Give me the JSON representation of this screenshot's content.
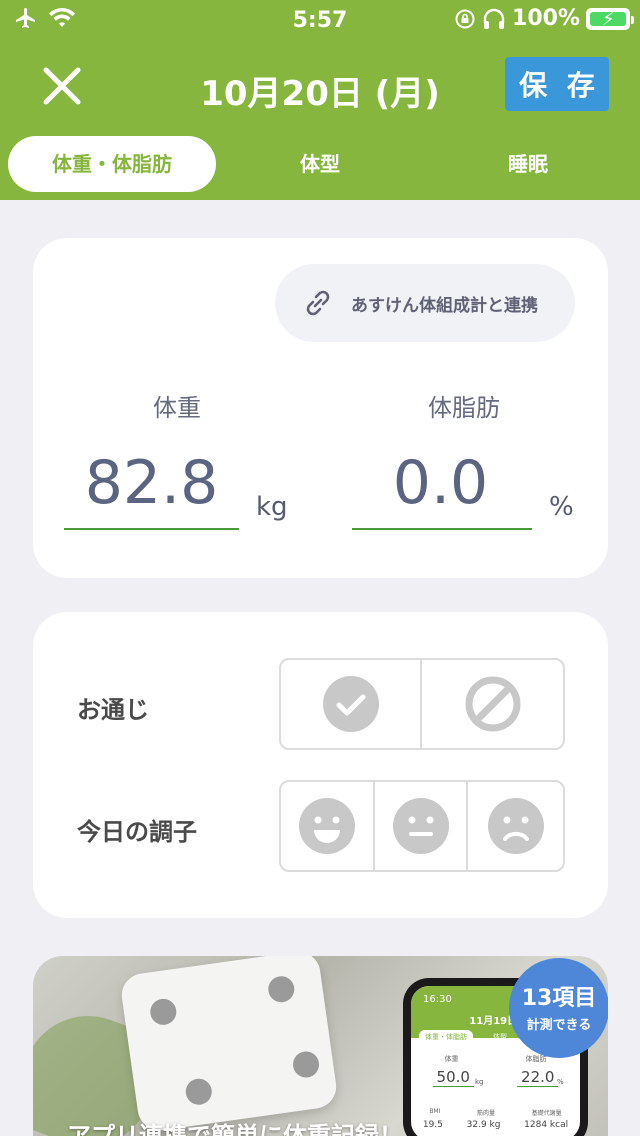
{
  "status_bar": {
    "time": "5:57",
    "battery": "100%",
    "icons": [
      "airplane-icon",
      "wifi-icon",
      "orientation-lock-icon",
      "headphones-icon",
      "battery-charging-icon"
    ]
  },
  "nav": {
    "title": "10月20日 (月)",
    "save_label": "保 存",
    "close_icon": "close-icon"
  },
  "tabs": [
    {
      "label": "体重・体脂肪",
      "active": true
    },
    {
      "label": "体型",
      "active": false
    },
    {
      "label": "睡眠",
      "active": false
    }
  ],
  "body_card": {
    "link_label": "あすけん体組成計と連携",
    "weight": {
      "label": "体重",
      "value": "82.8",
      "unit": "kg"
    },
    "body_fat": {
      "label": "体脂肪",
      "value": "0.0",
      "unit": "%"
    }
  },
  "condition_card": {
    "bowel": {
      "label": "お通じ",
      "options": [
        "check-icon",
        "none-icon"
      ]
    },
    "mood": {
      "label": "今日の調子",
      "options": [
        "smile-face-icon",
        "neutral-face-icon",
        "sad-face-icon"
      ]
    }
  },
  "banner": {
    "badge_number": "13項目",
    "badge_text": "計測できる",
    "caption": "アプリ連携で簡単に体重記録！",
    "phone": {
      "time": "16:30",
      "date": "11月19日(",
      "tab1": "体重・体脂肪",
      "tab2": "体型",
      "label_weight": "体重",
      "label_fat": "体脂肪",
      "value_weight": "50.0",
      "unit_weight": "kg",
      "value_fat": "22.0",
      "unit_fat": "%",
      "mini_labels": [
        "BMI",
        "筋肉量",
        "基礎代謝量"
      ],
      "mini_values": [
        "19.5",
        "32.9 kg",
        "1284 kcal"
      ]
    }
  },
  "colors": {
    "header_green": "#86b63d",
    "save_blue": "#3a97d9",
    "underline_green": "#4a9a3c",
    "icon_gray": "#c8c8c8"
  }
}
